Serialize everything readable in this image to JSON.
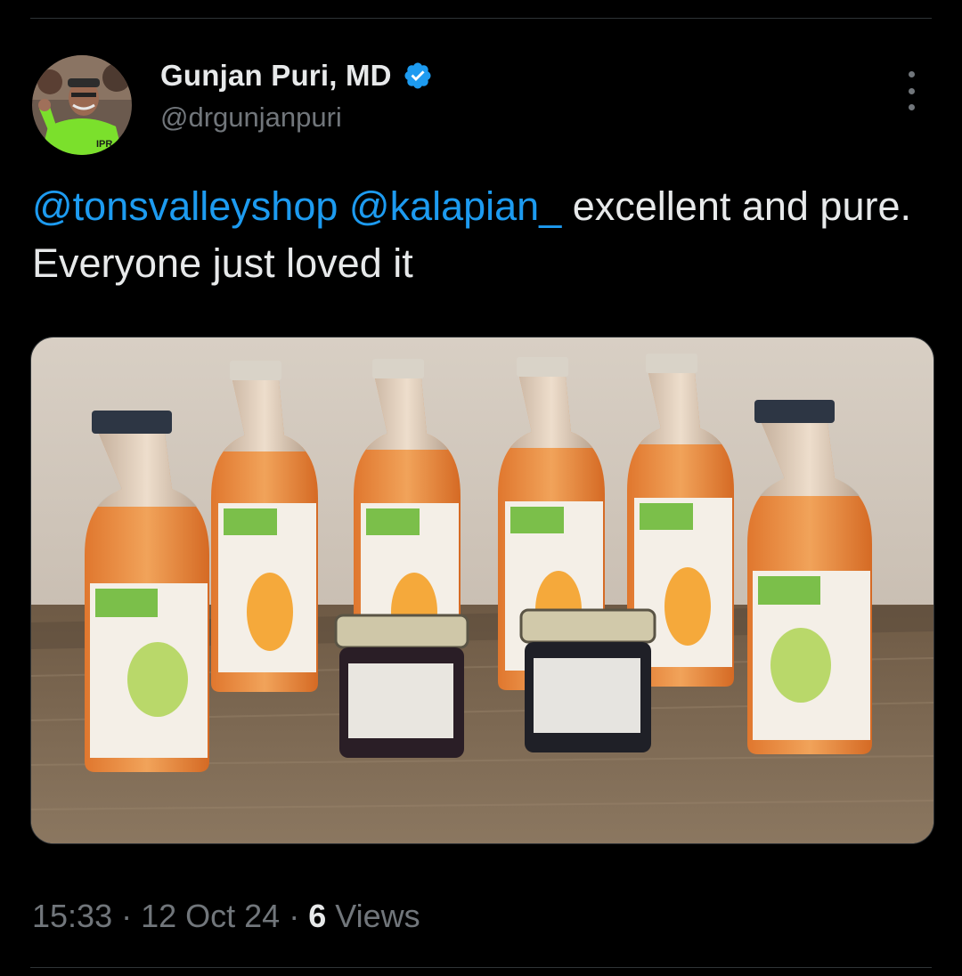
{
  "author": {
    "display_name": "Gunjan Puri, MD",
    "handle": "@drgunjanpuri",
    "verified": true,
    "avatar_shirt_text": "IPR"
  },
  "tweet": {
    "mention_1": "@tonsvalleyshop",
    "mention_2": "@kalapian_",
    "text_after_mentions": " excellent and pure. Everyone just loved it"
  },
  "meta": {
    "time": "15:33",
    "separator": "·",
    "date": "12 Oct 24",
    "views_count": "6",
    "views_label": "Views"
  },
  "colors": {
    "background": "#000000",
    "accent": "#1d9bf0",
    "secondary_text": "#71767b",
    "primary_text": "#e7e9ea"
  },
  "icons": {
    "verified": "verified-badge-icon",
    "more": "more-options-icon"
  }
}
